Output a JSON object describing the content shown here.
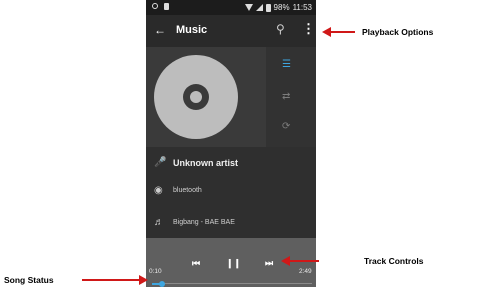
{
  "status_bar": {
    "battery": "98%",
    "time": "11:53"
  },
  "toolbar": {
    "title": "Music",
    "back_icon": "arrow-left-icon",
    "search_icon": "search-icon",
    "more_icon": "more-vertical-icon"
  },
  "side_icons": [
    "list-icon",
    "shuffle-icon",
    "repeat-icon"
  ],
  "track_info": {
    "artist": "Unknown artist",
    "album": "bluetooth",
    "track": "Bigbang - BAE BAE"
  },
  "playback": {
    "elapsed": "0:10",
    "duration": "2:49",
    "progress": 0.06
  },
  "callouts": {
    "playback_options": "Playback Options",
    "track_controls": "Track Controls",
    "song_status": "Song Status"
  },
  "colors": {
    "accent": "#3ea6e0",
    "arrow": "#d01818",
    "screen_bg": "#2f2f2f",
    "controls_bg": "#5f5f5f"
  }
}
